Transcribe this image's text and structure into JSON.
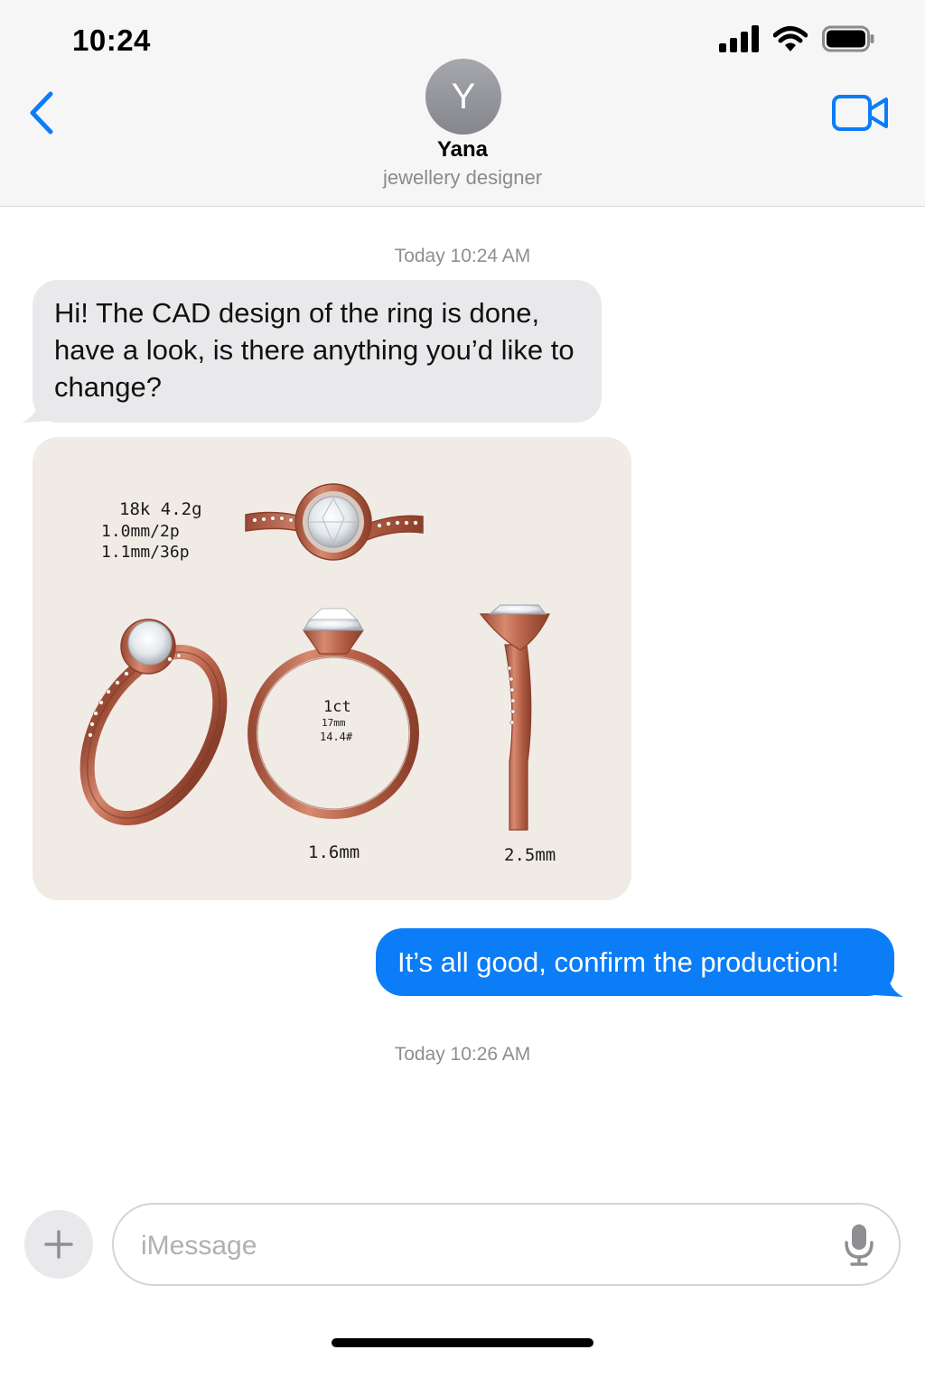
{
  "status_bar": {
    "time": "10:24",
    "icons": [
      "signal-icon",
      "wifi-icon",
      "battery-icon"
    ]
  },
  "header": {
    "avatar_initial": "Y",
    "contact_name": "Yana",
    "contact_subtitle": "jewellery designer",
    "icons": [
      "back-chevron-icon",
      "video-call-icon"
    ]
  },
  "messages": {
    "timestamp_1": "Today 10:24 AM",
    "incoming_text": "Hi! The CAD design of the ring is done, have a look, is there anything you’d like to change?",
    "attachment": {
      "spec_metal": "18k 4.2g",
      "spec_stones_1": "1.0mm/2p",
      "spec_stones_2": "1.1mm/36p",
      "center_stone": "1ct",
      "diameter": "17mm",
      "ring_size": "14.4#",
      "band_width_front": "1.6mm",
      "band_width_side": "2.5mm"
    },
    "outgoing_text": "It’s all good, confirm the production!",
    "timestamp_2": "Today 10:26 AM"
  },
  "composer": {
    "placeholder": "iMessage",
    "value": "",
    "icons": [
      "plus-icon",
      "microphone-icon"
    ]
  },
  "colors": {
    "accent": "#0b7df7",
    "incoming_bubble": "#e9e9eb",
    "header_bg": "#f6f6f7",
    "attachment_bg": "#f1ebe6",
    "rose_gold": "#c06a50"
  }
}
